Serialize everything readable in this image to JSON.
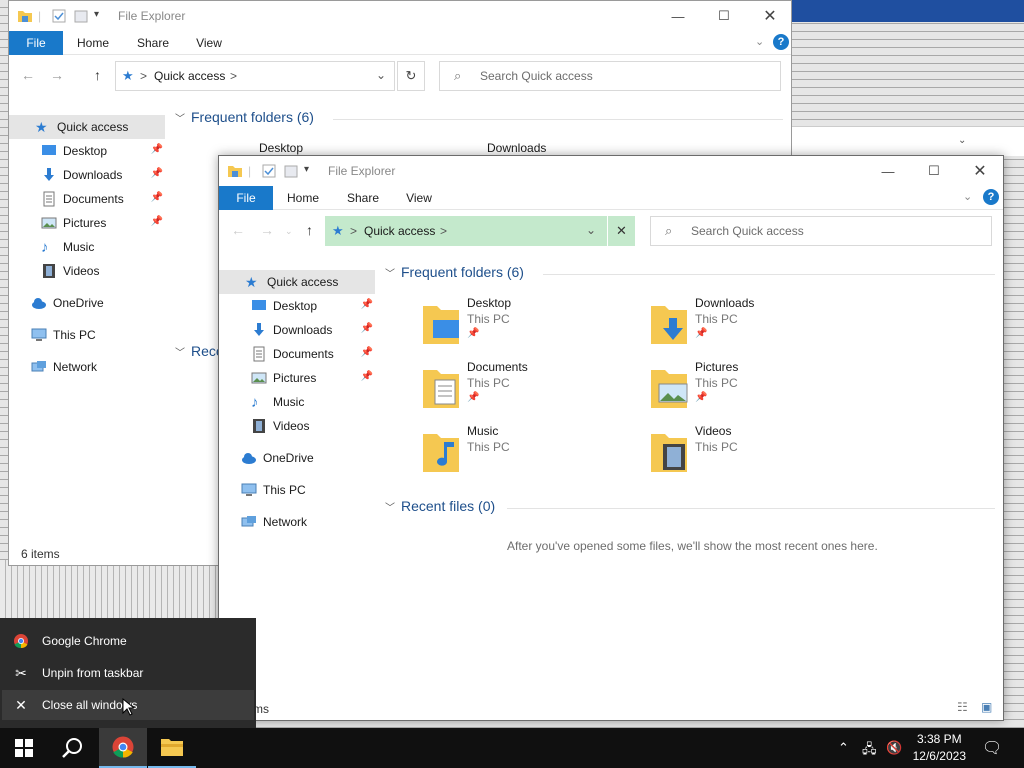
{
  "app": {
    "title": "File Explorer"
  },
  "ribbon": {
    "file": "File",
    "home": "Home",
    "share": "Share",
    "view": "View"
  },
  "address": {
    "location": "Quick access",
    "sep": ">"
  },
  "search": {
    "placeholder": "Search Quick access"
  },
  "sidebar": {
    "quick_access": "Quick access",
    "pinned": [
      {
        "label": "Desktop",
        "pinned": true
      },
      {
        "label": "Downloads",
        "pinned": true
      },
      {
        "label": "Documents",
        "pinned": true
      },
      {
        "label": "Pictures",
        "pinned": true
      },
      {
        "label": "Music",
        "pinned": false
      },
      {
        "label": "Videos",
        "pinned": false
      }
    ],
    "onedrive": "OneDrive",
    "thispc": "This PC",
    "network": "Network"
  },
  "main": {
    "frequent_header": "Frequent folders (6)",
    "recent_header": "Recent files (0)",
    "recent_header_partial": "Rece",
    "recent_empty": "After you've opened some files, we'll show the most recent ones here.",
    "folders": [
      {
        "name": "Desktop",
        "location": "This PC",
        "pinned": true
      },
      {
        "name": "Downloads",
        "location": "This PC",
        "pinned": true
      },
      {
        "name": "Documents",
        "location": "This PC",
        "pinned": true
      },
      {
        "name": "Pictures",
        "location": "This PC",
        "pinned": true
      },
      {
        "name": "Music",
        "location": "This PC",
        "pinned": false
      },
      {
        "name": "Videos",
        "location": "This PC",
        "pinned": false
      }
    ]
  },
  "status": {
    "back": "6 items",
    "front_partial": "ms"
  },
  "jumplist": {
    "items": [
      {
        "label": "Google Chrome",
        "icon": "chrome-icon"
      },
      {
        "label": "Unpin from taskbar",
        "icon": "unpin-icon"
      },
      {
        "label": "Close all windows",
        "icon": "close-icon"
      }
    ]
  },
  "taskbar": {
    "time": "3:38 PM",
    "date": "12/6/2023"
  },
  "colors": {
    "accent": "#1979ca",
    "address_highlight": "#c4e9cc",
    "folder": "#f5c851",
    "taskbar": "#101010"
  }
}
